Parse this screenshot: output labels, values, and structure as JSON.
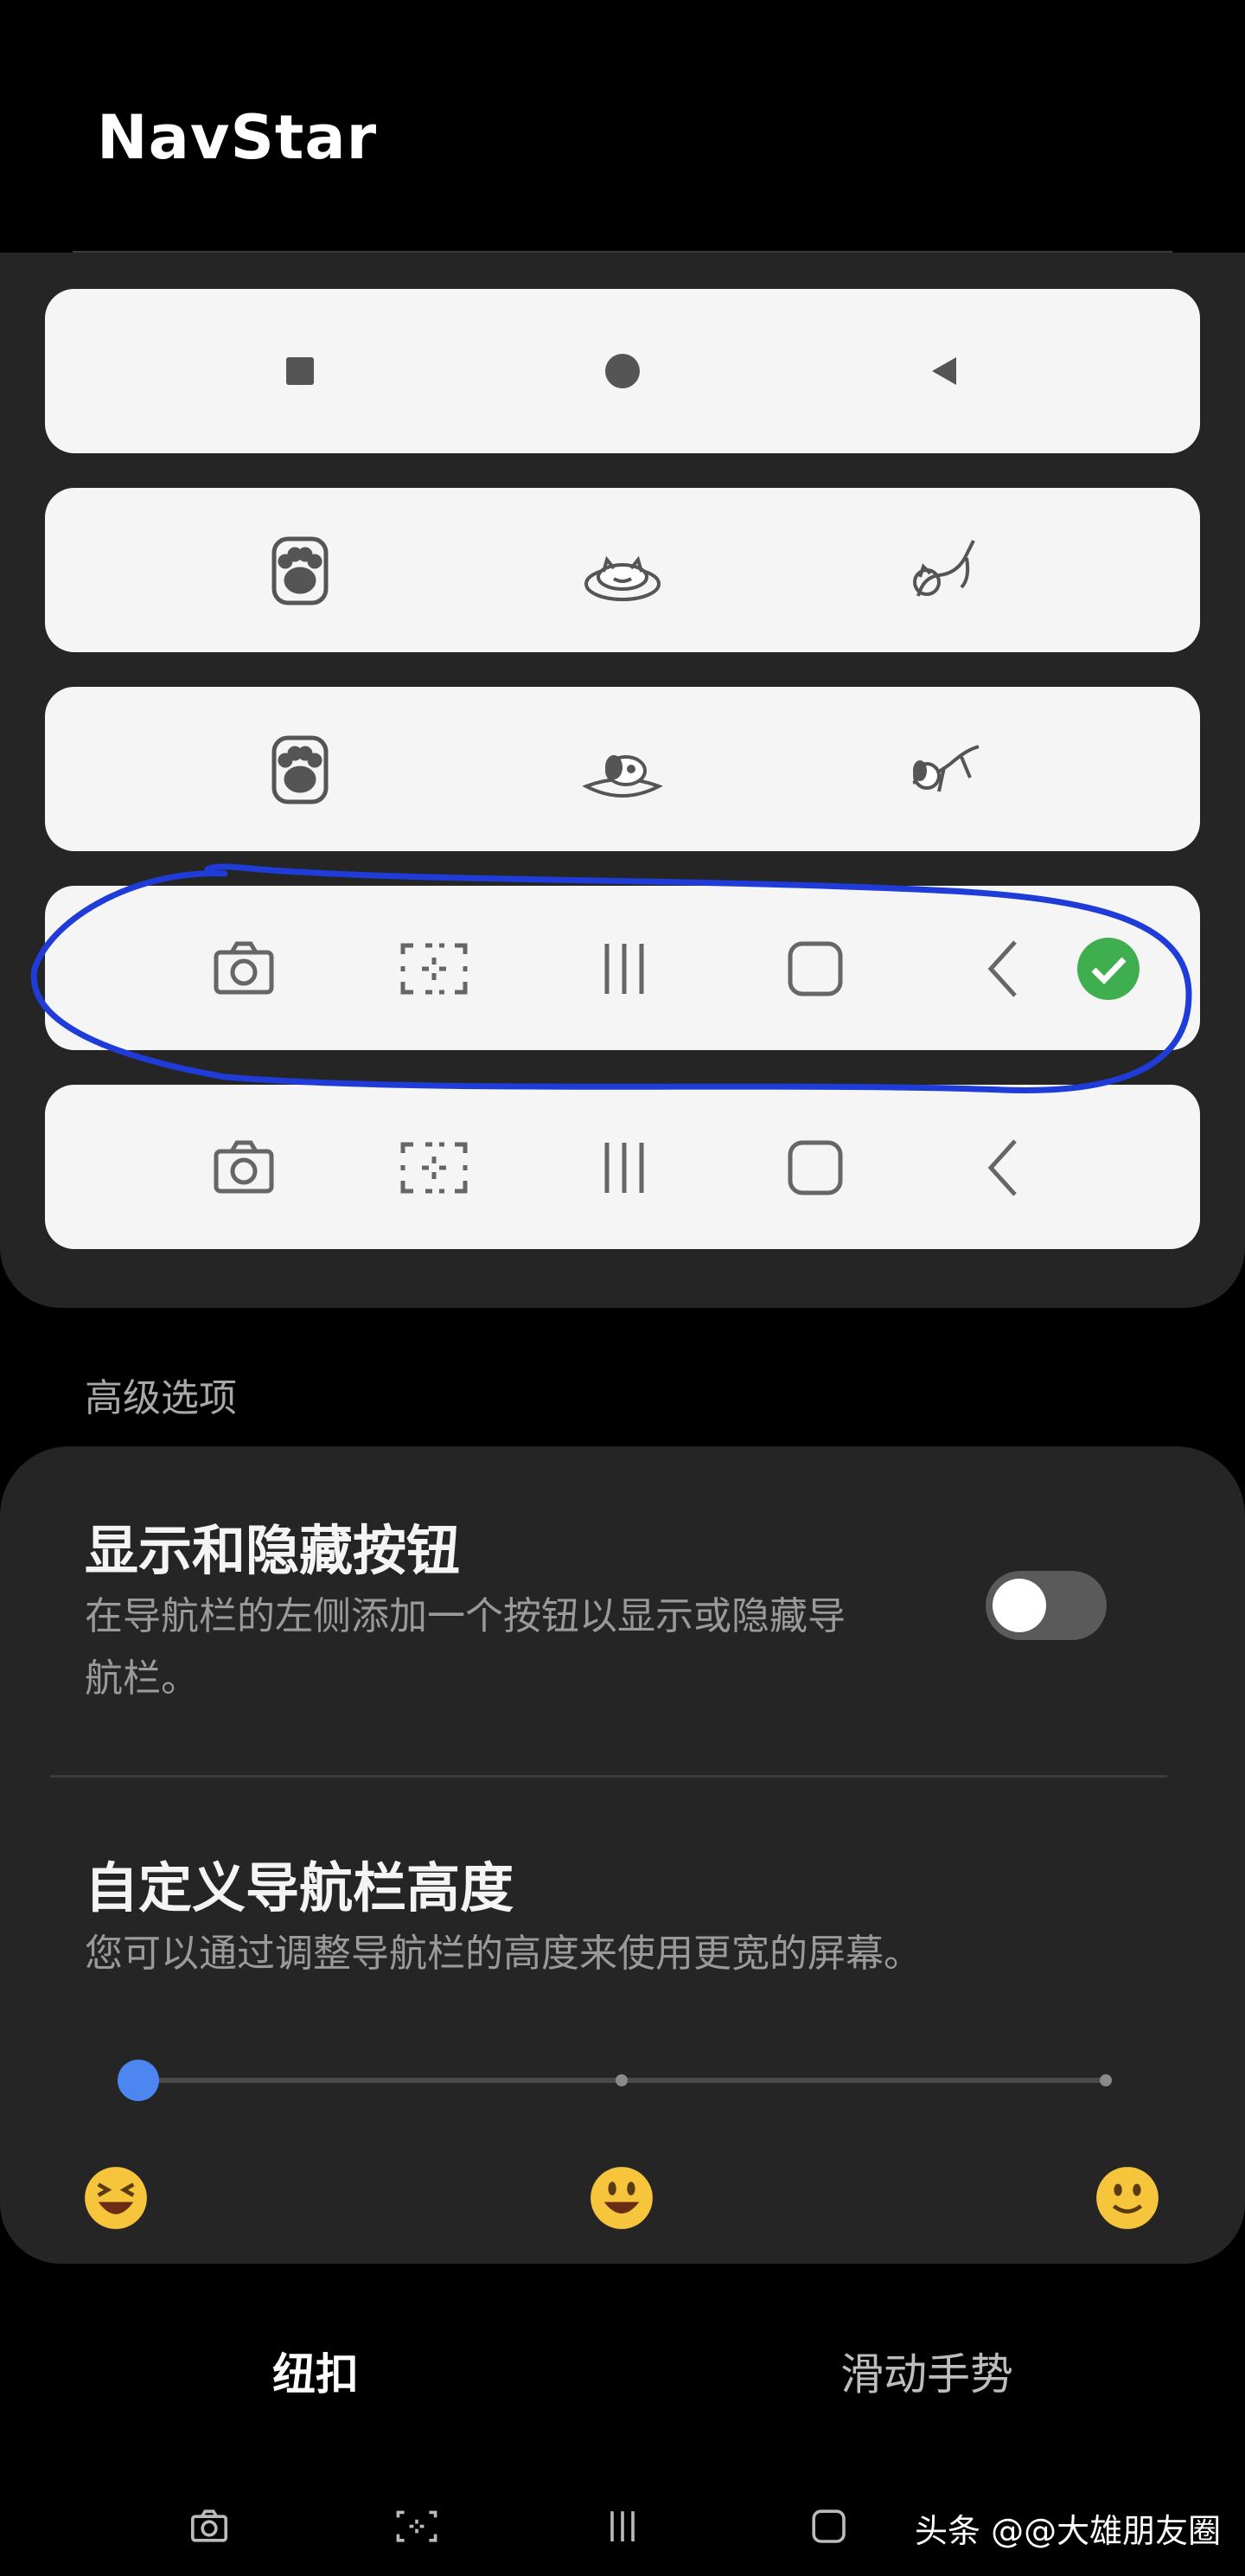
{
  "app": {
    "title": "NavStar"
  },
  "styles": {
    "options": [
      {
        "id": "classic",
        "selected": false,
        "icons": [
          "square-icon",
          "circle-icon",
          "triangle-back-icon"
        ]
      },
      {
        "id": "cats",
        "selected": false,
        "icons": [
          "paw-icon",
          "cat-sleeping-icon",
          "cat-stretch-icon"
        ]
      },
      {
        "id": "dogs",
        "selected": false,
        "icons": [
          "paw-icon",
          "dog-sleeping-icon",
          "dog-flying-icon"
        ]
      },
      {
        "id": "samsung-with-screenshot",
        "selected": true,
        "icons": [
          "camera-icon",
          "screenshot-icon",
          "recents-icon",
          "home-icon",
          "back-icon"
        ]
      },
      {
        "id": "samsung-with-screenshot-2",
        "selected": false,
        "icons": [
          "camera-icon",
          "screenshot-icon",
          "recents-icon",
          "home-icon",
          "back-icon"
        ]
      }
    ]
  },
  "advanced": {
    "label": "高级选项",
    "show_hide": {
      "title": "显示和隐藏按钮",
      "description_line1": "在导航栏的左侧添加一个按钮以显示或隐藏导",
      "description_line2": "航栏。",
      "enabled": false
    },
    "height": {
      "title": "自定义导航栏高度",
      "description": "您可以通过调整导航栏的高度来使用更宽的屏幕。",
      "slider_value": 0,
      "slider_steps": 3,
      "emojis": [
        "grinning-squint-icon",
        "smiley-icon",
        "slight-smile-icon"
      ]
    }
  },
  "tabs": {
    "buttons": "纽扣",
    "gestures": "滑动手势"
  },
  "watermark": "头条 @@大雄朋友圈",
  "colors": {
    "accent": "#4d86f0",
    "check": "#3fae4f",
    "highlight": "#1f3bd8"
  }
}
